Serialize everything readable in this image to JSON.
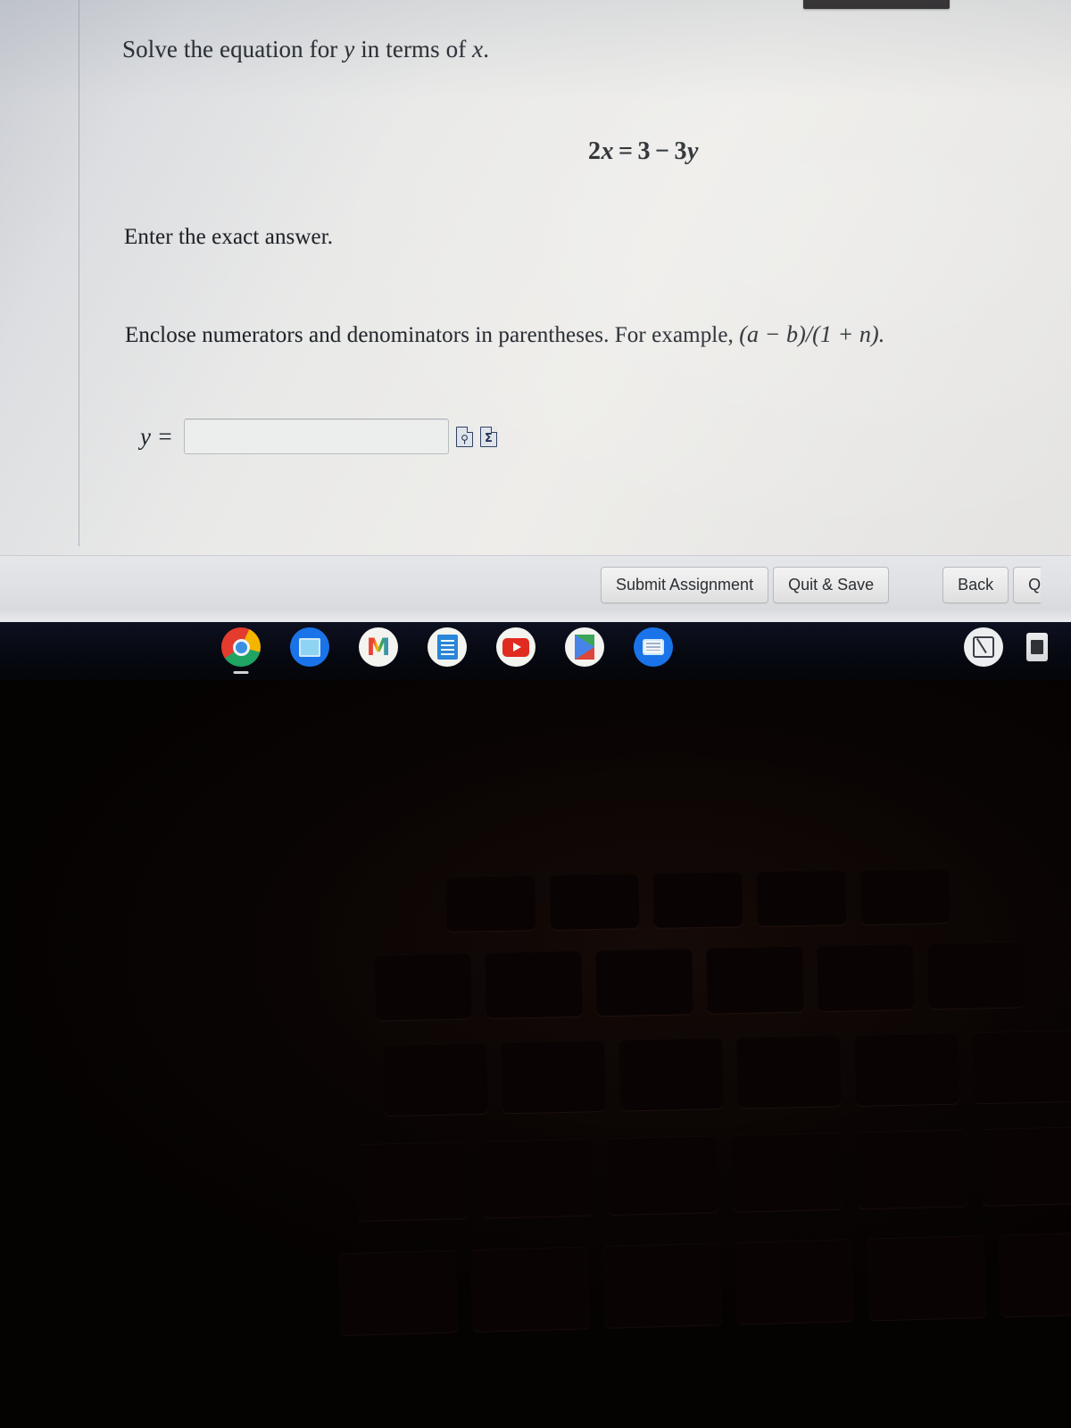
{
  "window": {
    "top_bar_visible": true
  },
  "question": {
    "prompt_prefix": "Solve the equation for",
    "prompt_var1": "y",
    "prompt_middle": "in terms of",
    "prompt_var2": "x",
    "prompt_suffix": ".",
    "equation": {
      "lhs_coefficient": "2",
      "lhs_variable": "x",
      "equals": "=",
      "rhs_constant": "3",
      "rhs_operator": "−",
      "rhs_coefficient": "3",
      "rhs_variable": "y",
      "full_text": "2x = 3 − 3y"
    },
    "instruction_exact": "Enter the exact answer.",
    "instruction_enclose_prefix": "Enclose numerators and denominators in parentheses. For example,",
    "instruction_enclose_example": "(a − b)/(1 + n).",
    "answer": {
      "label": "y =",
      "value": "",
      "placeholder": ""
    },
    "tools": [
      {
        "name": "preview-icon",
        "glyph": "⚲",
        "title": "Preview"
      },
      {
        "name": "equation-editor-icon",
        "glyph": "Σ",
        "title": "Equation editor"
      }
    ]
  },
  "toolbar": {
    "submit_label": "Submit Assignment",
    "quit_save_label": "Quit & Save",
    "back_label": "Back",
    "next_label_clipped": "Q"
  },
  "shelf": {
    "apps": [
      {
        "name": "chrome",
        "label": "Chrome",
        "active": true
      },
      {
        "name": "calculator",
        "label": "Calculator",
        "active": false
      },
      {
        "name": "gmail",
        "label": "Gmail",
        "glyph": "M",
        "active": false
      },
      {
        "name": "docs",
        "label": "Docs",
        "active": false
      },
      {
        "name": "youtube",
        "label": "YouTube",
        "active": false
      },
      {
        "name": "play-store",
        "label": "Play Store",
        "active": false
      },
      {
        "name": "messages",
        "label": "Messages",
        "active": false
      }
    ],
    "status": [
      {
        "name": "screenshot-tool",
        "label": "Screen capture"
      },
      {
        "name": "battery",
        "label": "Battery"
      }
    ]
  },
  "colors": {
    "page_background": "#e9e9e8",
    "shelf_background": "#070911",
    "text": "#1e2328",
    "input_border": "#b7bcc0",
    "icon_outline": "#2c3f63",
    "keyboard": "#050202"
  }
}
